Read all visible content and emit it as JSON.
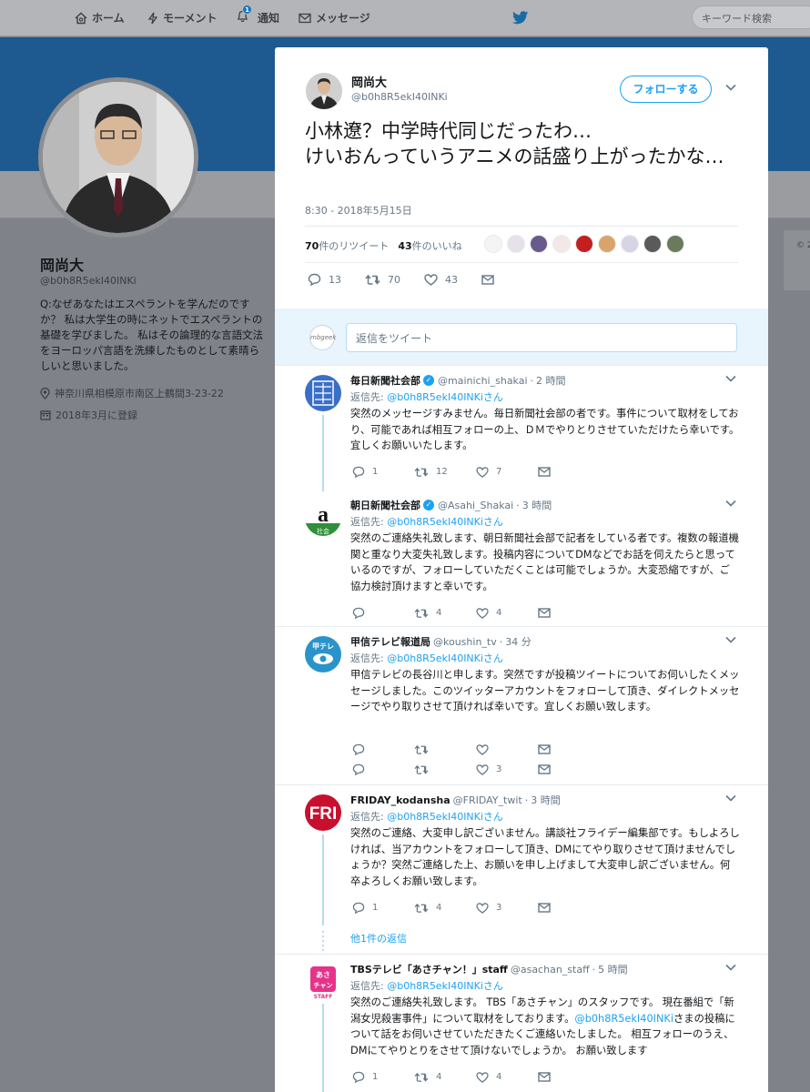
{
  "nav": {
    "home": "ホーム",
    "moments": "モーメント",
    "notifications": "通知",
    "notif_count": "1",
    "messages": "メッセージ",
    "search_placeholder": "キーワード検索"
  },
  "profile": {
    "name": "岡尚大",
    "handle": "@b0h8R5ekI40INKi",
    "bio": "Q:なぜあなたはエスペラントを学んだのですか？ 私は大学生の時にネットでエスペラントの基礎を学びました。 私はその論理的な言語文法をヨーロッパ言語を洗練したものとして素晴らしいと思いました。",
    "location": "神奈川県相模原市南区上鶴間3-23-22",
    "joined": "2018年3月に登録",
    "right_card_text": "© 2"
  },
  "tweet": {
    "name": "岡尚大",
    "handle": "@b0h8R5ekI40INKi",
    "follow_label": "フォローする",
    "text": "小林遼？中学時代同じだったわ…\nけいおんっていうアニメの話盛り上がったかな…",
    "timestamp": "8:30 - 2018年5月15日",
    "retweets_num": "70",
    "retweets_label": "件のリツイート",
    "likes_num": "43",
    "likes_label": "件のいいね",
    "reply_count": "13",
    "retweet_count": "70",
    "like_count": "43"
  },
  "reply_box": {
    "placeholder": "返信をツイート",
    "avatar_text": "mbgeek"
  },
  "replies": [
    {
      "name": "毎日新聞社会部",
      "handle": "@mainichi_shakai",
      "time": "2 時間",
      "reply_to_label": "返信先:",
      "reply_to": "@b0h8R5ekI40INKiさん",
      "body": "突然のメッセージすみません。毎日新聞社会部の者です。事件について取材をしており、可能であれば相互フォローの上、ＤＭでやりとりさせていただけたら幸いです。宜しくお願いいたします。",
      "replies": "1",
      "retweets": "12",
      "likes": "7"
    },
    {
      "name": "朝日新聞社会部",
      "handle": "@Asahi_Shakai",
      "time": "3 時間",
      "reply_to_label": "返信先:",
      "reply_to": "@b0h8R5ekI40INKiさん",
      "body": "突然のご連絡失礼致します、朝日新聞社会部で記者をしている者です。複数の報道機関と重なり大変失礼致します。投稿内容についてDMなどでお話を伺えたらと思っているのですが、フォローしていただくことは可能でしょうか。大変恐縮ですが、ご協力検討頂けますと幸いです。",
      "replies": "",
      "retweets": "4",
      "likes": "4"
    },
    {
      "name": "甲信テレビ報道局",
      "handle": "@koushin_tv",
      "time": "34 分",
      "reply_to_label": "返信先:",
      "reply_to": "@b0h8R5ekI40INKiさん",
      "body": "甲信テレビの長谷川と申します。突然ですが投稿ツイートについてお伺いしたくメッセージしました。このツイッターアカウントをフォローして頂き、ダイレクトメッセージでやり取りさせて頂ければ幸いです。宜しくお願い致します。",
      "replies": "",
      "retweets": "",
      "likes": "",
      "replies2": "",
      "retweets2": "",
      "likes2": "3"
    },
    {
      "name": "FRIDAY_kodansha",
      "handle": "@FRIDAY_twit",
      "time": "3 時間",
      "reply_to_label": "返信先:",
      "reply_to": "@b0h8R5ekI40INKiさん",
      "body": "突然のご連絡、大変申し訳ございません。講談社フライデー編集部です。もしよろしければ、当アカウントをフォローして頂き、DMにてやり取りさせて頂けませんでしょうか？突然ご連絡した上、お願いを申し上げまして大変申し訳ございません。何卒よろしくお願い致します。",
      "replies": "1",
      "retweets": "4",
      "likes": "3",
      "more": "他1件の返信"
    },
    {
      "name": "TBSテレビ「あさチャン！」staff",
      "handle": "@asachan_staff",
      "time": "5 時間",
      "reply_to_label": "返信先:",
      "reply_to": "@b0h8R5ekI40INKiさん",
      "body_1": "突然のご連絡失礼致します。 TBS「あさチャン」のスタッフです。 現在番組で「新潟女児殺害事件」について取材をしております。",
      "body_link": "@b0h8R5ekI40INKi",
      "body_2": "さまの投稿について話をお伺いさせていただきたくご連絡いたしました。 相互フォローのうえ、DMにてやりとりをさせて頂けないでしょうか。 お願い致します",
      "replies": "1",
      "retweets": "4",
      "likes": "4"
    }
  ],
  "colors": {
    "accent": "#1da1f2",
    "banner": "#1e5a8f",
    "overlay": "#7f8389"
  }
}
